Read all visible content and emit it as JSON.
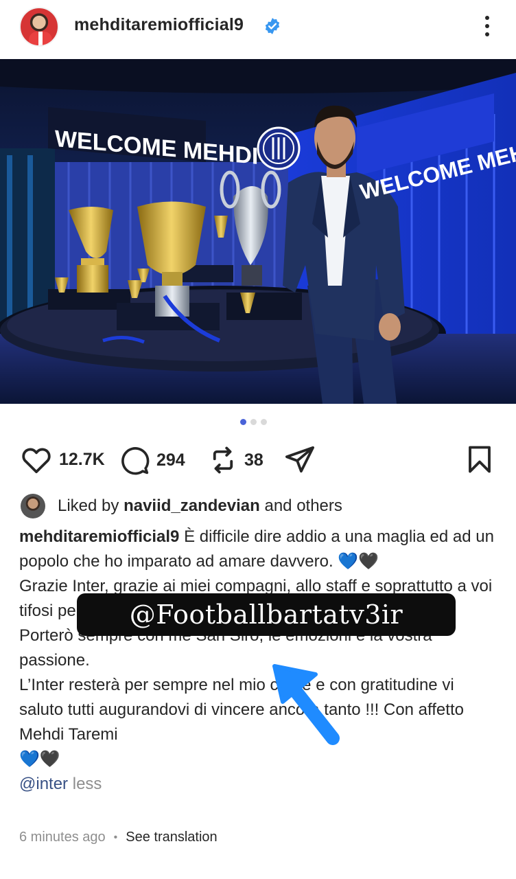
{
  "header": {
    "username": "mehditaremiofficial9",
    "verified": true,
    "verified_color": "#3897f0",
    "more_icon": "more-vertical-icon"
  },
  "post_image": {
    "banner_left": "WELCOME MEHDI",
    "banner_right": "WELCOME MEHDI",
    "carousel_count": 3,
    "carousel_active": 1
  },
  "actions": {
    "likes": "12.7K",
    "comments": "294",
    "reposts": "38",
    "like_icon": "heart-icon",
    "comment_icon": "comment-icon",
    "repost_icon": "repost-icon",
    "share_icon": "share-icon",
    "save_icon": "bookmark-icon"
  },
  "liked_by": {
    "prefix": "Liked by ",
    "user": "naviid_zandevian",
    "suffix": " and others"
  },
  "caption": {
    "user": "mehditaremiofficial9",
    "line1": " È difficile dire addio a una maglia ed ad un popolo che ho imparato ad amare davvero. 💙🖤",
    "line2": "Grazie Inter, grazie ai miei compagni, allo staff e soprattutto a voi tifosi per tutto quello che mi avete dato.",
    "line3": "Porterò sempre con me San Siro, le emozioni e la vostra passione.",
    "line4": "L’Inter resterà per sempre nel mio cuore e con gratitudine vi saluto tutti augurandovi di vincere ancora tanto !!! Con affetto Mehdi Taremi",
    "line5": "💙🖤",
    "mention": "@inter",
    "less": "less"
  },
  "meta": {
    "time": "6 minutes ago",
    "separator": "•",
    "translate": "See translation"
  },
  "watermark": {
    "text": "@Footballbartatv3ir"
  },
  "colors": {
    "accent_blue": "#4a63d8",
    "arrow_blue": "#1f8bff",
    "text": "#262626",
    "muted": "#8e8e8e"
  }
}
